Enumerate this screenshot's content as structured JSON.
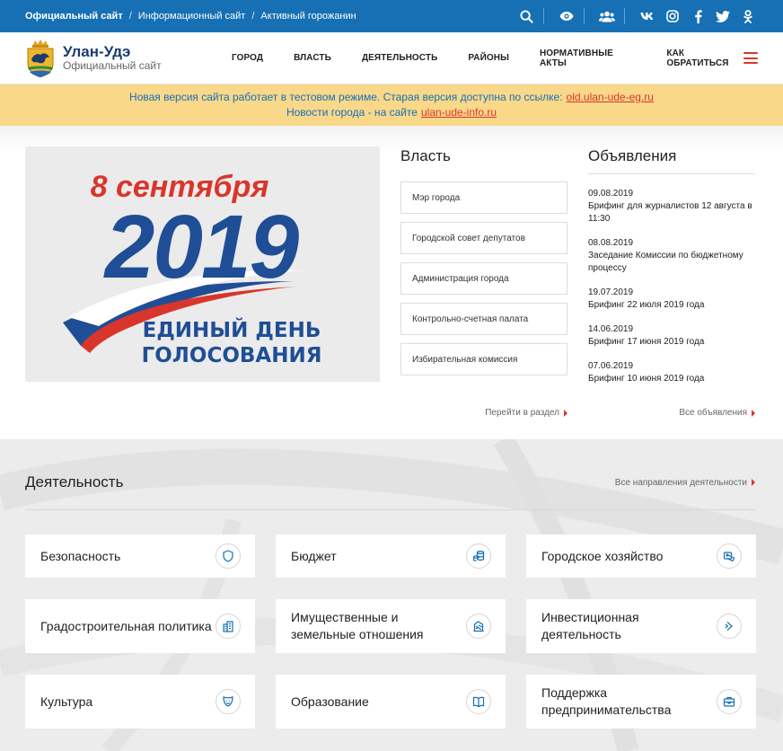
{
  "topbar": {
    "breadcrumbs": [
      "Официальный сайт",
      "Информационный сайт",
      "Активный горожанин"
    ],
    "icons": [
      "search-icon",
      "eye-icon",
      "users-icon",
      "vk-icon",
      "instagram-icon",
      "facebook-icon",
      "twitter-icon",
      "odnoklassniki-icon"
    ]
  },
  "header": {
    "logo_title": "Улан-Удэ",
    "logo_subtitle": "Официальный сайт",
    "nav": [
      "ГОРОД",
      "ВЛАСТЬ",
      "ДЕЯТЕЛЬНОСТЬ",
      "РАЙОНЫ",
      "НОРМАТИВНЫЕ АКТЫ",
      "КАК ОБРАТИТЬСЯ"
    ]
  },
  "notice": {
    "line1": "Новая версия сайта работает в тестовом режиме. Старая версия доступна по ссылке:",
    "line1_link": "old.ulan-ude-eg.ru",
    "line2": "Новости города - на сайте",
    "line2_link": "ulan-ude-info.ru"
  },
  "banner": {
    "date": "8 сентября",
    "year": "2019",
    "line1": "ЕДИНЫЙ ДЕНЬ",
    "line2": "ГОЛОСОВАНИЯ"
  },
  "vlast": {
    "title": "Власть",
    "links": [
      "Мэр города",
      "Городской совет депутатов",
      "Администрация города",
      "Контрольно-счетная палата",
      "Избирательная комиссия"
    ],
    "more": "Перейти в раздел"
  },
  "ads": {
    "title": "Объявления",
    "items": [
      {
        "date": "09.08.2019",
        "text": "Брифинг для журналистов 12 августа в 11:30"
      },
      {
        "date": "08.08.2019",
        "text": "Заседание Комиссии по бюджетному процессу"
      },
      {
        "date": "19.07.2019",
        "text": "Брифинг 22 июля 2019 года"
      },
      {
        "date": "14.06.2019",
        "text": "Брифинг 17 июня 2019 года"
      },
      {
        "date": "07.06.2019",
        "text": "Брифинг 10 июня 2019 года"
      }
    ],
    "more": "Все объявления"
  },
  "activity": {
    "title": "Деятельность",
    "more": "Все направления деятельности",
    "cards": [
      {
        "label": "Безопасность",
        "icon": "shield-icon"
      },
      {
        "label": "Бюджет",
        "icon": "coins-icon"
      },
      {
        "label": "Городское хозяйство",
        "icon": "house-icon"
      },
      {
        "label": "Градостроительная политика",
        "icon": "buildings-icon"
      },
      {
        "label": "Имущественные и земельные отношения",
        "icon": "land-icon"
      },
      {
        "label": "Инвестиционная деятельность",
        "icon": "chevron-right-icon"
      },
      {
        "label": "Культура",
        "icon": "theater-icon"
      },
      {
        "label": "Образование",
        "icon": "book-icon"
      },
      {
        "label": "Поддержка предпринимательства",
        "icon": "briefcase-icon"
      }
    ]
  },
  "colors": {
    "primary": "#1670b3",
    "accent": "#d9362b",
    "notice_bg": "#f9d88a",
    "logo_text": "#1b3d6d"
  }
}
